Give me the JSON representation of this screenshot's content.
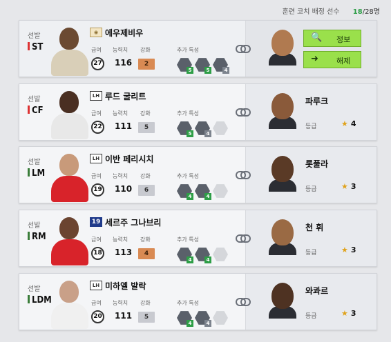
{
  "header": {
    "title": "훈련 코치 배정 선수",
    "count_current": "18",
    "count_sep": "/",
    "count_max": "28명"
  },
  "labels": {
    "starter": "선발",
    "salary": "급여",
    "ovr": "능력치",
    "upgrade": "강화",
    "traits": "추가 특성",
    "grade": "등급"
  },
  "buttons": {
    "info": "정보",
    "release": "해제"
  },
  "players": [
    {
      "pos": "ST",
      "season_icon": "icon-st",
      "season_text": "◉",
      "name": "에우제비우",
      "salary": "27",
      "ovr": "116",
      "upgrade": "2",
      "upgrade_color": "bronze",
      "traits": [
        "5",
        "5",
        "4"
      ],
      "coach_name": "",
      "coach_grade": ""
    },
    {
      "pos": "CF",
      "season_icon": "lh",
      "season_text": "LH",
      "name": "루드 굴리트",
      "salary": "22",
      "ovr": "111",
      "upgrade": "5",
      "upgrade_color": "gray",
      "traits": [
        "5",
        "4",
        ""
      ],
      "coach_name": "파루크",
      "coach_grade": "4"
    },
    {
      "pos": "LM",
      "season_icon": "lh",
      "season_text": "LH",
      "name": "이반 페리시치",
      "salary": "19",
      "ovr": "110",
      "upgrade": "6",
      "upgrade_color": "gray",
      "traits": [
        "4",
        "4",
        ""
      ],
      "coach_name": "롯풀라",
      "coach_grade": "3"
    },
    {
      "pos": "RM",
      "season_icon": "icon-19",
      "season_text": "19",
      "name": "세르주 그나브리",
      "salary": "18",
      "ovr": "113",
      "upgrade": "4",
      "upgrade_color": "bronze",
      "traits": [
        "4",
        "4",
        ""
      ],
      "coach_name": "천 휘",
      "coach_grade": "3"
    },
    {
      "pos": "LDM",
      "season_icon": "lh",
      "season_text": "LH",
      "name": "미하엘 발락",
      "salary": "20",
      "ovr": "111",
      "upgrade": "5",
      "upgrade_color": "gray",
      "traits": [
        "4",
        "4",
        ""
      ],
      "coach_name": "와콰르",
      "coach_grade": "3"
    }
  ],
  "colors": {
    "accent": "#9ae04b",
    "star": "#e0a21a",
    "count_current": "#2e9e47"
  }
}
